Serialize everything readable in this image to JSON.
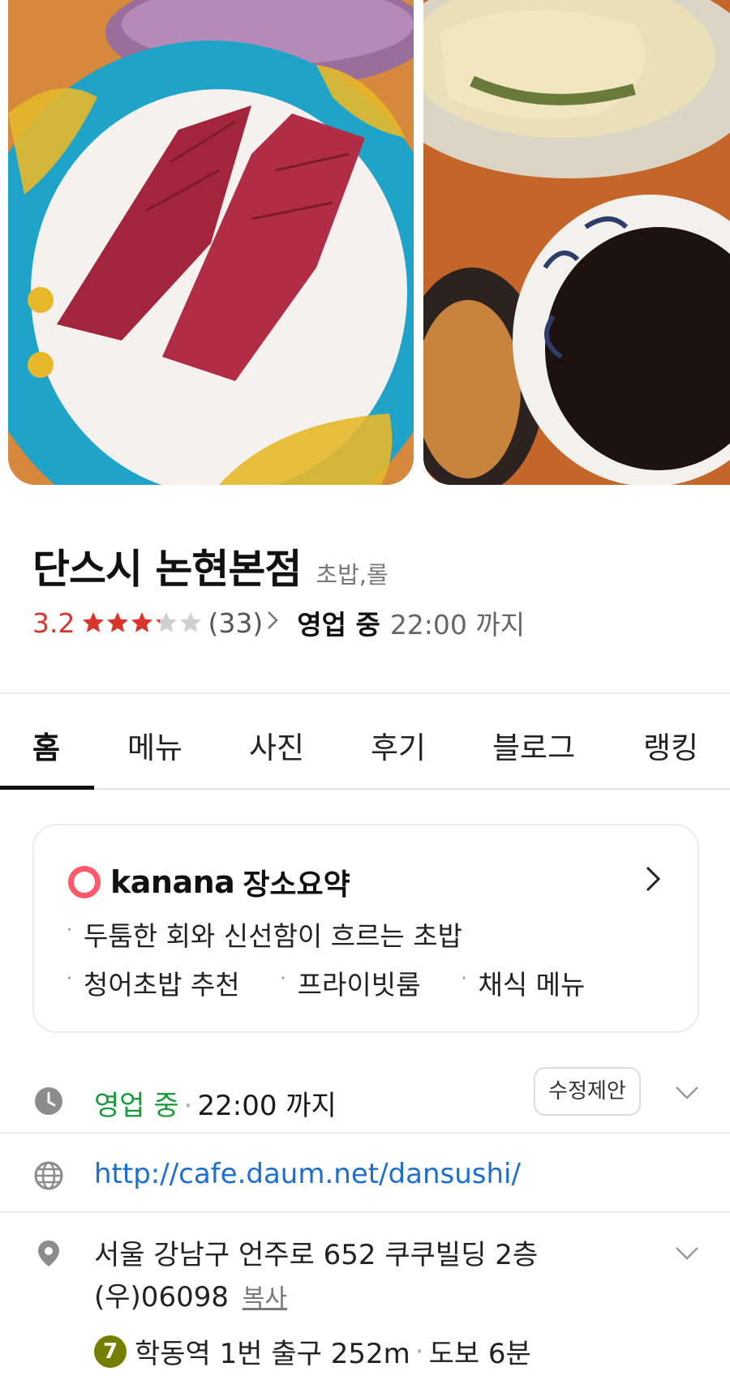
{
  "place": {
    "name": "단스시 논현본점",
    "category": "초밥,롤",
    "rating": "3.2",
    "rating_value": 3.2,
    "stars_max": 5,
    "review_count": "(33)",
    "open_status": "영업 중",
    "close_time": "22:00 까지"
  },
  "photos": [
    {
      "icon": "tuna-sushi-photo"
    },
    {
      "icon": "tempura-soy-sauce-photo"
    }
  ],
  "tabs": [
    {
      "label": "홈",
      "active": true
    },
    {
      "label": "메뉴",
      "active": false
    },
    {
      "label": "사진",
      "active": false
    },
    {
      "label": "후기",
      "active": false
    },
    {
      "label": "블로그",
      "active": false
    },
    {
      "label": "랭킹",
      "active": false
    }
  ],
  "summary": {
    "brand": "kanana",
    "title": "장소요약",
    "line1": "두툼한 회와 신선함이 흐르는 초밥",
    "keywords": [
      "청어초밥 추천",
      "프라이빗룸",
      "채식 메뉴"
    ],
    "bullet": "·"
  },
  "hours": {
    "status": "영업 중",
    "separator": "·",
    "time": "22:00 까지",
    "suggest_label": "수정제안"
  },
  "website": {
    "url": "http://cafe.daum.net/dansushi/"
  },
  "address": {
    "text": "서울 강남구 언주로 652 쿠쿠빌딩 2층 (우)06098",
    "copy_label": "복사",
    "subway_line": "7",
    "subway_text": "학동역 1번 출구 252m",
    "separator": "·",
    "walk_text": "도보 6분"
  },
  "colors": {
    "rating": "#d9352c",
    "open_green": "#189a3a",
    "link_blue": "#1a6fd1",
    "line7": "#747f00",
    "kanana_ring": "#ff5a6a"
  }
}
